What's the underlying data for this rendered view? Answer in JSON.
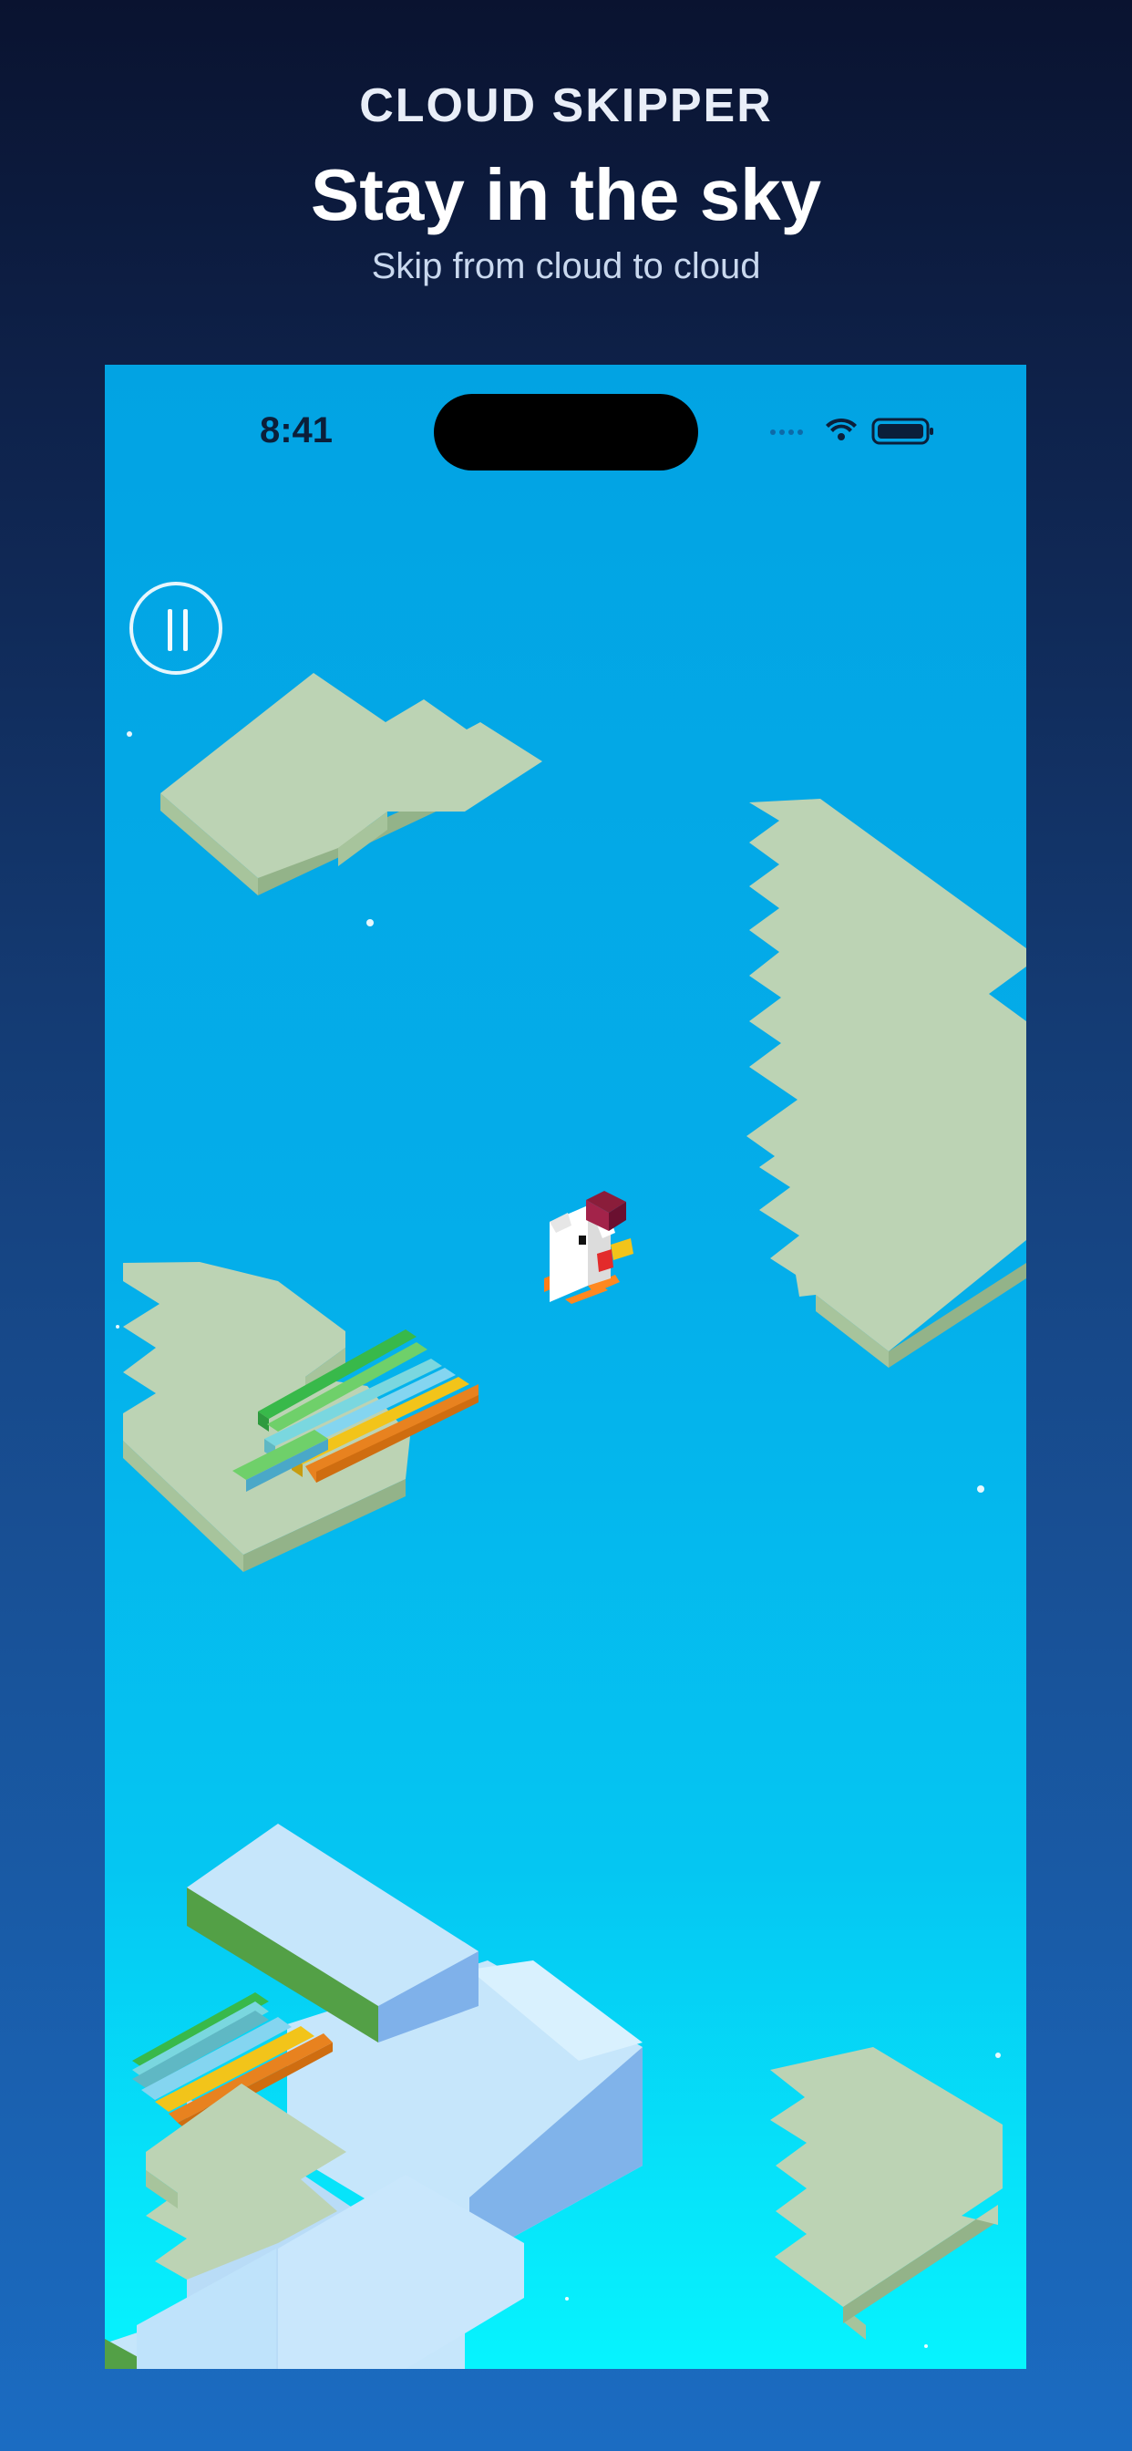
{
  "promo": {
    "app_name": "CLOUD SKIPPER",
    "headline": "Stay in the sky",
    "subhead": "Skip from cloud to cloud"
  },
  "status_bar": {
    "time": "8:41",
    "icons": [
      "signal-dots-icon",
      "wifi-icon",
      "battery-icon"
    ]
  },
  "game": {
    "controls": {
      "pause_icon": "pause-icon"
    },
    "sprites": {
      "player": "chicken",
      "platforms": [
        "cloud-platform",
        "ice-block-path",
        "rainbow-bridge"
      ]
    }
  },
  "colors": {
    "sky_top": "#02a3e3",
    "sky_bottom": "#06f4fe",
    "cloud_top": "#bcd3b4",
    "cloud_side": "#a7c49c",
    "ice_top": "#c6e6fb",
    "ice_side": "#7fb1ea",
    "grass_side": "#53a046"
  }
}
